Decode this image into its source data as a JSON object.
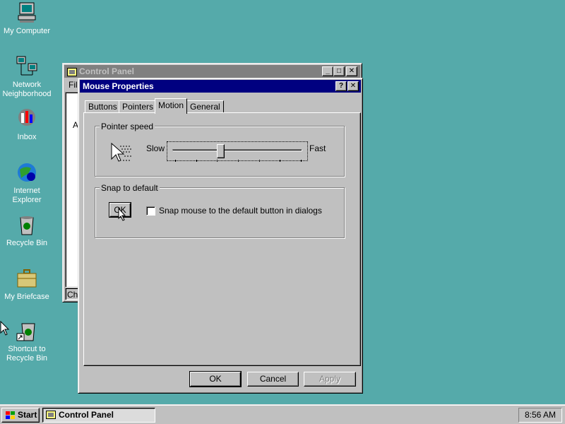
{
  "desktop": {
    "icons": [
      {
        "label": "My Computer",
        "icon": "my-computer-icon"
      },
      {
        "label": "Network Neighborhood",
        "icon": "network-neighborhood-icon"
      },
      {
        "label": "Inbox",
        "icon": "inbox-icon"
      },
      {
        "label": "Internet Explorer",
        "icon": "internet-explorer-icon"
      },
      {
        "label": "Recycle Bin",
        "icon": "recycle-bin-icon"
      },
      {
        "label": "My Briefcase",
        "icon": "briefcase-icon"
      },
      {
        "label": "Shortcut to Recycle Bin",
        "icon": "recycle-bin-shortcut-icon"
      }
    ],
    "background_color": "#55aaaa"
  },
  "control_panel": {
    "title": "Control Panel",
    "menu_fragment": "Fil",
    "list_fragment": "A",
    "status_fragment": "Ch"
  },
  "mouse_properties": {
    "title": "Mouse Properties",
    "help_glyph": "?",
    "close_glyph": "✕",
    "tabs": [
      {
        "label": "Buttons",
        "active": false
      },
      {
        "label": "Pointers",
        "active": false
      },
      {
        "label": "Motion",
        "active": true
      },
      {
        "label": "General",
        "active": false
      }
    ],
    "pointer_speed": {
      "group_title": "Pointer speed",
      "slow_label": "Slow",
      "fast_label": "Fast",
      "level_fraction": 0.36,
      "tick_count": 7
    },
    "snap_to_default": {
      "group_title": "Snap to default",
      "preview_button_label": "OK",
      "checkbox_label": "Snap mouse to the default button in dialogs",
      "checked": false
    },
    "buttons": {
      "ok": "OK",
      "cancel": "Cancel",
      "apply": "Apply"
    }
  },
  "taskbar": {
    "start_label": "Start",
    "task_label": "Control Panel",
    "clock": "8:56 AM"
  },
  "colors": {
    "title_active": "#000080",
    "title_inactive": "#808080",
    "face": "#c0c0c0"
  }
}
